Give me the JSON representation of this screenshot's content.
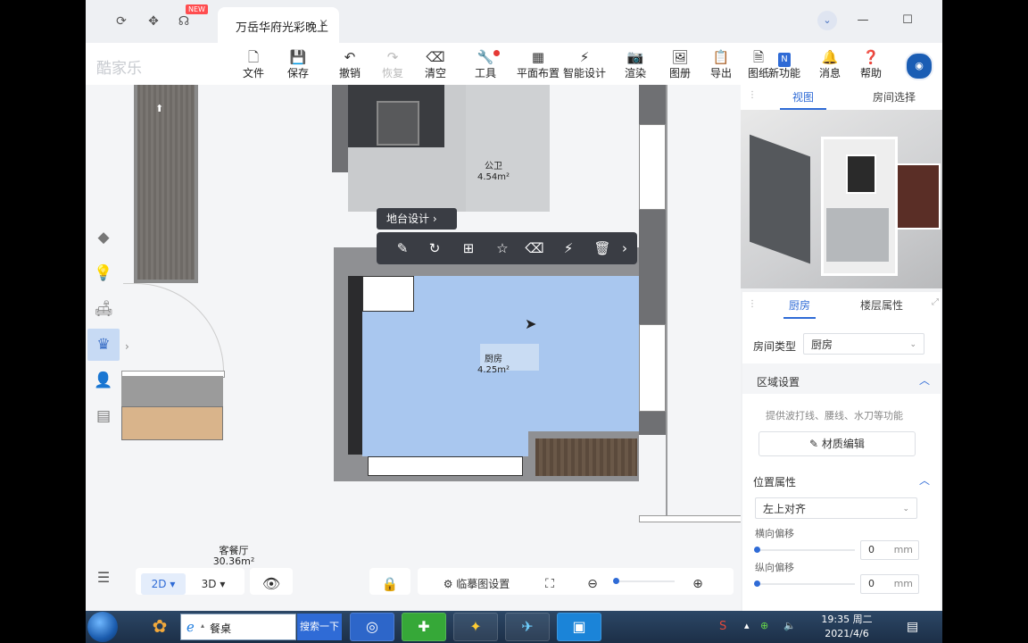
{
  "browser": {
    "tab_title": "万岳华府光彩晚上",
    "tab_close": "×",
    "new_badge": "NEW"
  },
  "toolbar": {
    "logo": "酷家乐",
    "items": [
      {
        "label": "文件",
        "icon": "file-icon"
      },
      {
        "label": "保存",
        "icon": "save-icon"
      },
      {
        "label": "撤销",
        "icon": "undo-icon"
      },
      {
        "label": "恢复",
        "icon": "redo-icon"
      },
      {
        "label": "清空",
        "icon": "eraser-icon"
      },
      {
        "label": "工具",
        "icon": "wrench-icon"
      },
      {
        "label": "平面布置",
        "icon": "layout-icon"
      },
      {
        "label": "智能设计",
        "icon": "lightning-icon"
      },
      {
        "label": "渲染",
        "icon": "camera-icon"
      },
      {
        "label": "图册",
        "icon": "album-icon"
      },
      {
        "label": "导出",
        "icon": "export-icon"
      },
      {
        "label": "图纸",
        "icon": "drawing-icon"
      },
      {
        "label": "新功能",
        "icon": "new-feature-icon"
      },
      {
        "label": "消息",
        "icon": "bell-icon"
      },
      {
        "label": "帮助",
        "icon": "help-icon"
      }
    ],
    "new_feature_badge": "N"
  },
  "canvas": {
    "rooms": [
      {
        "name": "公卫",
        "area": "4.54m²"
      },
      {
        "name": "厨房",
        "area": "4.25m²"
      },
      {
        "name": "客餐厅",
        "area": "30.36m²"
      }
    ],
    "popup": "地台设计",
    "float_tools": [
      "edit-icon",
      "rotate-icon",
      "duplicate-icon",
      "favorite-icon",
      "erase-icon",
      "smart-icon",
      "delete-icon"
    ]
  },
  "bottom": {
    "view_2d": "2D",
    "view_3d": "3D",
    "blueprint_settings": "临摹图设置"
  },
  "right_panel": {
    "view_tabs": [
      "视图",
      "房间选择"
    ],
    "prop_tabs": [
      "厨房",
      "楼层属性"
    ],
    "room_type_label": "房间类型",
    "room_type_value": "厨房",
    "area_settings": "区域设置",
    "area_hint": "提供波打线、腰线、水刀等功能",
    "material_edit": "材质编辑",
    "position_props": "位置属性",
    "align_value": "左上对齐",
    "h_offset_label": "横向偏移",
    "h_offset_value": "0",
    "v_offset_label": "纵向偏移",
    "v_offset_value": "0",
    "unit": "mm"
  },
  "taskbar": {
    "ie_label": "餐桌",
    "search_label": "搜索一下",
    "time": "19:35 周二",
    "date": "2021/4/6"
  },
  "colors": {
    "accent": "#2f6bd6",
    "kitchen_fill": "#a9c7ef",
    "wall": "#6f7073"
  }
}
